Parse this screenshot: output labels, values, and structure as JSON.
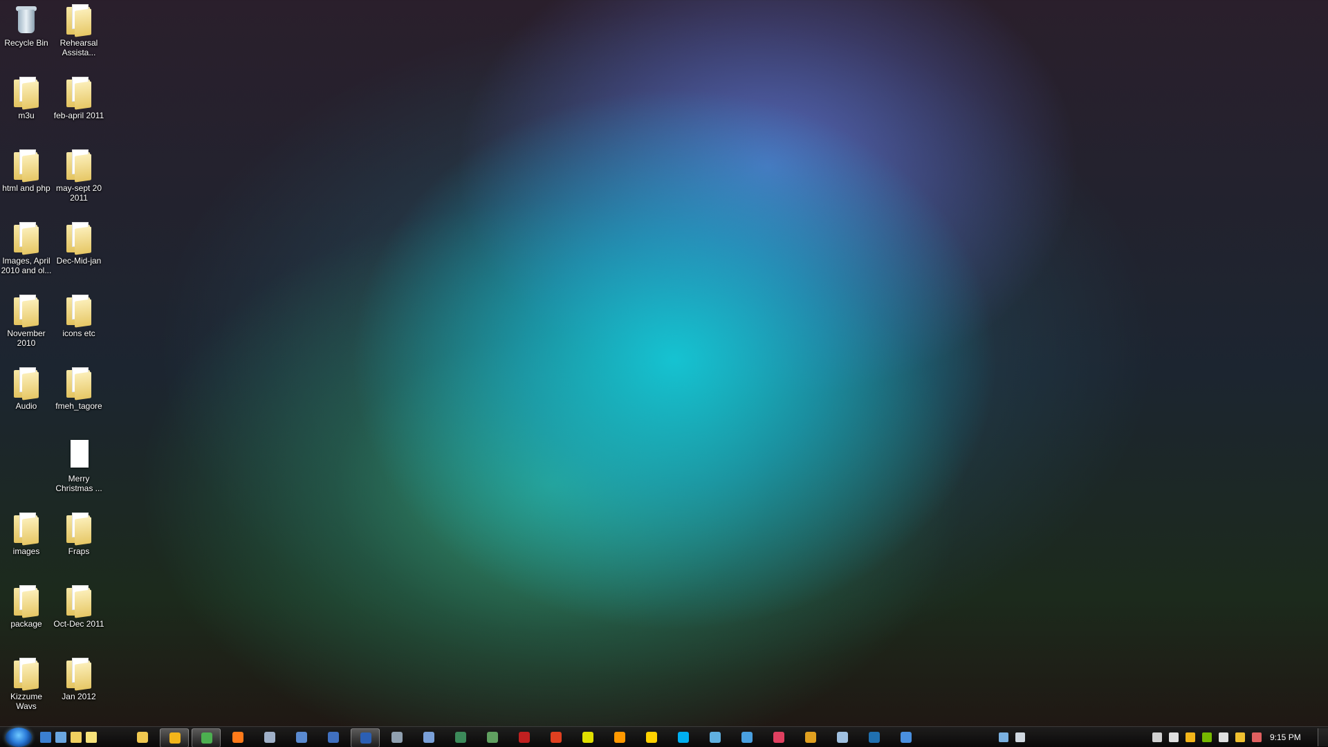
{
  "desktop": {
    "icons": [
      {
        "label": "Recycle Bin",
        "type": "bin"
      },
      {
        "label": "Rehearsal Assista...",
        "type": "folder"
      },
      {
        "label": "m3u",
        "type": "folder"
      },
      {
        "label": "feb-april 2011",
        "type": "folder"
      },
      {
        "label": "html and php",
        "type": "folder"
      },
      {
        "label": "may-sept 20 2011",
        "type": "folder"
      },
      {
        "label": "Images, April 2010 and ol...",
        "type": "folder"
      },
      {
        "label": "Dec-Mid-jan",
        "type": "folder"
      },
      {
        "label": "November 2010",
        "type": "folder"
      },
      {
        "label": "icons etc",
        "type": "folder"
      },
      {
        "label": "Audio",
        "type": "folder"
      },
      {
        "label": "fmeh_tagore",
        "type": "folder"
      },
      {
        "label": "Merry Christmas ...",
        "type": "document"
      },
      {
        "label": "images",
        "type": "folder"
      },
      {
        "label": "Fraps",
        "type": "folder"
      },
      {
        "label": "package",
        "type": "folder"
      },
      {
        "label": "Oct-Dec 2011",
        "type": "folder"
      },
      {
        "label": "Kizzume Wavs",
        "type": "folder"
      },
      {
        "label": "Jan 2012",
        "type": "folder"
      }
    ]
  },
  "taskbar": {
    "start_icon": "windows-start-orb-icon",
    "quick_launch": [
      {
        "icon": "show-desktop-icon",
        "color": "#3b7fd1"
      },
      {
        "icon": "computer-icon",
        "color": "#6aa6e0"
      },
      {
        "icon": "notes-icon",
        "color": "#f0d060"
      },
      {
        "icon": "sticky-note-icon",
        "color": "#f6e27a"
      }
    ],
    "apps": [
      {
        "icon": "windows-explorer-icon",
        "color": "#f0c850",
        "active": false
      },
      {
        "icon": "outlook-icon",
        "color": "#f3b51a",
        "active": true
      },
      {
        "icon": "chrome-icon",
        "color": "#4caf50",
        "active": true
      },
      {
        "icon": "firefox-icon",
        "color": "#ff7a1a",
        "active": false
      },
      {
        "icon": "app-icon",
        "color": "#a0b0c8",
        "active": false
      },
      {
        "icon": "app-icon",
        "color": "#5a8ad0",
        "active": false
      },
      {
        "icon": "app-icon",
        "color": "#4070c0",
        "active": false
      },
      {
        "icon": "word-icon",
        "color": "#2b5fb4",
        "active": true
      },
      {
        "icon": "app-icon",
        "color": "#90a0b0",
        "active": false
      },
      {
        "icon": "app-icon",
        "color": "#7aa0d8",
        "active": false
      },
      {
        "icon": "app-icon",
        "color": "#3c8a5a",
        "active": false
      },
      {
        "icon": "app-icon",
        "color": "#60a060",
        "active": false
      },
      {
        "icon": "app-icon",
        "color": "#c02020",
        "active": false
      },
      {
        "icon": "app-icon",
        "color": "#e04020",
        "active": false
      },
      {
        "icon": "app-icon",
        "color": "#e0e000",
        "active": false
      },
      {
        "icon": "app-icon",
        "color": "#ff9900",
        "active": false
      },
      {
        "icon": "app-icon",
        "color": "#ffd200",
        "active": false
      },
      {
        "icon": "skype-icon",
        "color": "#00aff0",
        "active": false
      },
      {
        "icon": "app-icon",
        "color": "#60b0e0",
        "active": false
      },
      {
        "icon": "app-icon",
        "color": "#4aa0e0",
        "active": false
      },
      {
        "icon": "app-icon",
        "color": "#e04060",
        "active": false
      },
      {
        "icon": "app-icon",
        "color": "#e0a020",
        "active": false
      },
      {
        "icon": "app-icon",
        "color": "#a0c0e0",
        "active": false
      },
      {
        "icon": "app-icon",
        "color": "#2070b0",
        "active": false
      },
      {
        "icon": "app-icon",
        "color": "#4a90e0",
        "active": false
      }
    ],
    "tray": [
      {
        "icon": "network-share-icon",
        "color": "#7ab0e0"
      },
      {
        "icon": "drive-icon",
        "color": "#d0d8e0"
      },
      {
        "icon": "action-center-icon",
        "color": "#d0d0d0"
      },
      {
        "icon": "flag-icon",
        "color": "#e0e0e0"
      },
      {
        "icon": "outlook-tray-icon",
        "color": "#f3b51a"
      },
      {
        "icon": "nvidia-icon",
        "color": "#76b900"
      },
      {
        "icon": "volume-icon",
        "color": "#e0e0e0"
      },
      {
        "icon": "headset-icon",
        "color": "#f0c030"
      },
      {
        "icon": "speaker-icon",
        "color": "#e06060"
      }
    ],
    "clock": "9:15 PM"
  }
}
